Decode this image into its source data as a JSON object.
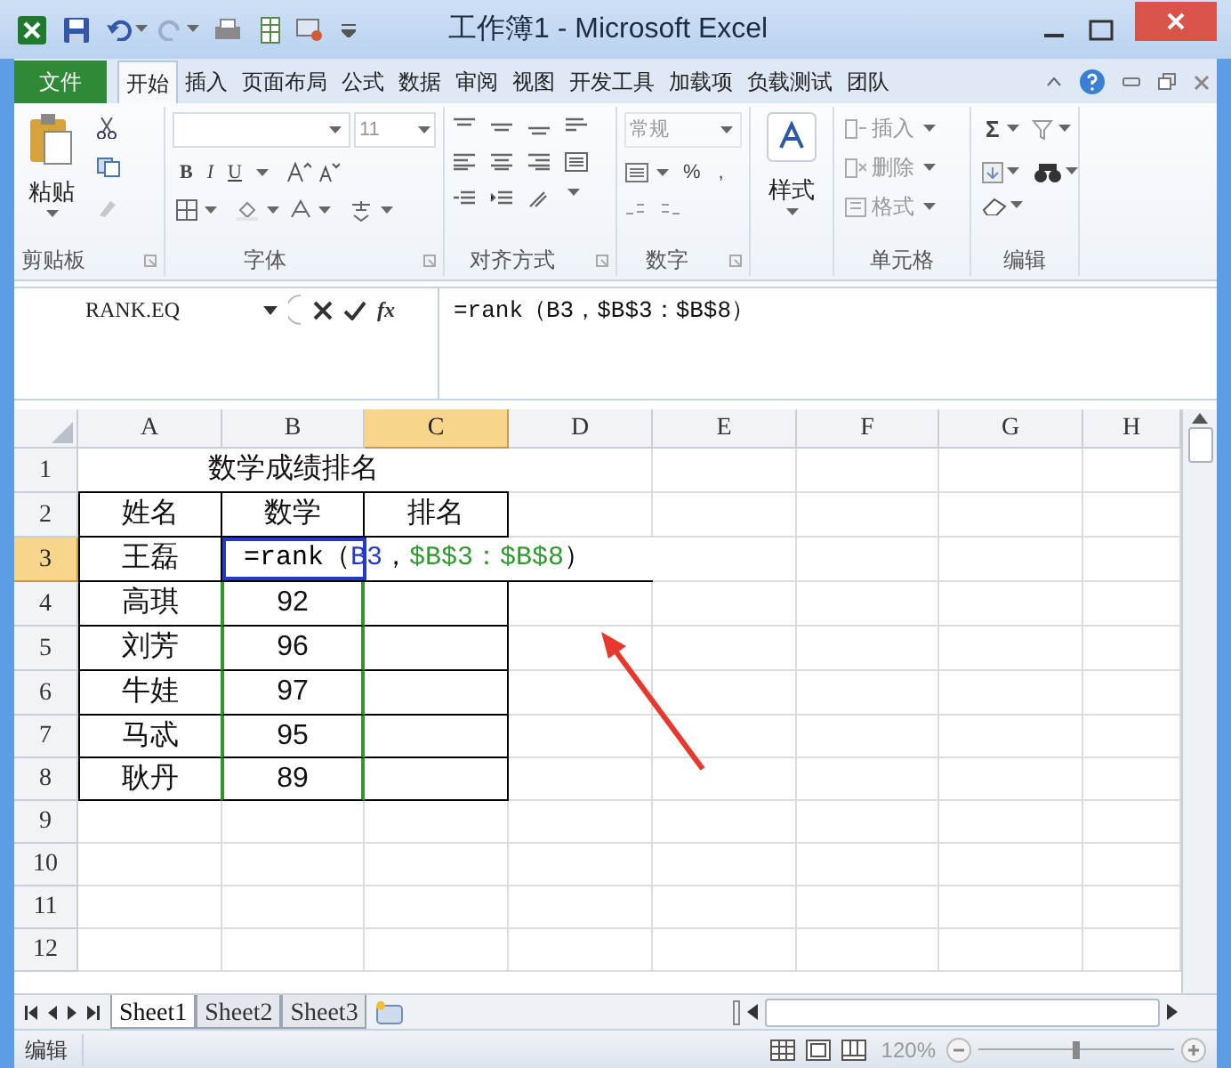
{
  "window": {
    "title": "工作簿1 - Microsoft Excel"
  },
  "ribbon_tabs": [
    {
      "label": "文件",
      "kind": "file",
      "selected": false
    },
    {
      "label": "开始",
      "kind": "tab",
      "selected": true
    },
    {
      "label": "插入",
      "kind": "tab",
      "selected": false
    },
    {
      "label": "页面布局",
      "kind": "tab",
      "selected": false
    },
    {
      "label": "公式",
      "kind": "tab",
      "selected": false
    },
    {
      "label": "数据",
      "kind": "tab",
      "selected": false
    },
    {
      "label": "审阅",
      "kind": "tab",
      "selected": false
    },
    {
      "label": "视图",
      "kind": "tab",
      "selected": false
    },
    {
      "label": "开发工具",
      "kind": "tab",
      "selected": false
    },
    {
      "label": "加载项",
      "kind": "tab",
      "selected": false
    },
    {
      "label": "负载测试",
      "kind": "tab",
      "selected": false
    },
    {
      "label": "团队",
      "kind": "tab",
      "selected": false
    }
  ],
  "ribbon": {
    "clipboard": {
      "paste": "粘贴",
      "label": "剪贴板"
    },
    "font": {
      "size": "11",
      "bold": "B",
      "italic": "I",
      "underline": "U",
      "label": "字体"
    },
    "alignment": {
      "label": "对齐方式"
    },
    "number": {
      "format": "常规",
      "percent": "%",
      "comma": ",",
      "label": "数字"
    },
    "styles": {
      "button": "样式"
    },
    "cells": {
      "insert": "插入",
      "delete": "删除",
      "format": "格式",
      "label": "单元格"
    },
    "editing": {
      "sum": "Σ",
      "label": "编辑"
    }
  },
  "formula_bar": {
    "name_box": "RANK.EQ",
    "function_button": "fx",
    "formula": "=rank（B3，$B$3：$B$8）"
  },
  "sheet": {
    "columns": [
      {
        "label": "A",
        "selected": false
      },
      {
        "label": "B",
        "selected": false
      },
      {
        "label": "C",
        "selected": true
      },
      {
        "label": "D",
        "selected": false
      },
      {
        "label": "E",
        "selected": false
      },
      {
        "label": "F",
        "selected": false
      },
      {
        "label": "G",
        "selected": false
      },
      {
        "label": "H",
        "selected": false
      }
    ],
    "rows": [
      {
        "label": "1",
        "selected": false
      },
      {
        "label": "2",
        "selected": false
      },
      {
        "label": "3",
        "selected": true
      },
      {
        "label": "4",
        "selected": false
      },
      {
        "label": "5",
        "selected": false
      },
      {
        "label": "6",
        "selected": false
      },
      {
        "label": "7",
        "selected": false
      },
      {
        "label": "8",
        "selected": false
      },
      {
        "label": "9",
        "selected": false
      },
      {
        "label": "10",
        "selected": false
      },
      {
        "label": "11",
        "selected": false
      },
      {
        "label": "12",
        "selected": false
      }
    ],
    "title": "数学成绩排名",
    "header": [
      "姓名",
      "数学",
      "排名"
    ],
    "records": [
      {
        "name": "王磊"
      },
      {
        "name": "高琪",
        "score": "92"
      },
      {
        "name": "刘芳",
        "score": "96"
      },
      {
        "name": "牛娃",
        "score": "97"
      },
      {
        "name": "马忒",
        "score": "95"
      },
      {
        "name": "耿丹",
        "score": "89"
      }
    ],
    "editing_cell": {
      "segments": [
        {
          "text": "=rank（",
          "color": "#000000"
        },
        {
          "text": "B3",
          "color": "#2339c8"
        },
        {
          "text": "，",
          "color": "#000000"
        },
        {
          "text": "$B$3：$B$8",
          "color": "#2e9a2e"
        },
        {
          "text": "）",
          "color": "#000000"
        }
      ]
    }
  },
  "sheet_tabs": [
    {
      "label": "Sheet1",
      "selected": true
    },
    {
      "label": "Sheet2",
      "selected": false
    },
    {
      "label": "Sheet3",
      "selected": false
    }
  ],
  "status_bar": {
    "mode": "编辑",
    "zoom": "120%",
    "zoom_level": {
      "level": 0.5
    }
  }
}
